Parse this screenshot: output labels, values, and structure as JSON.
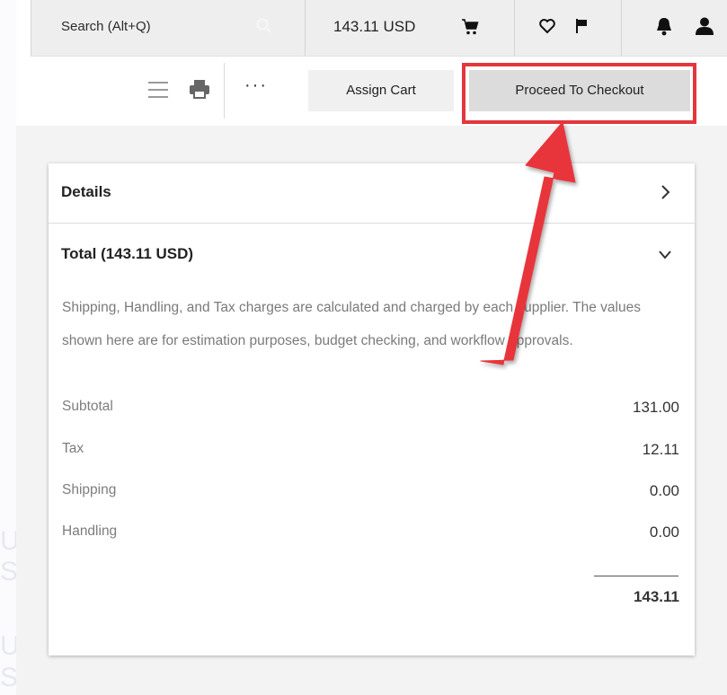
{
  "topbar": {
    "search_placeholder": "Search (Alt+Q)",
    "cart_total": "143.11 USD",
    "icons": [
      "search-icon",
      "cart-icon",
      "heart-icon",
      "flag-icon",
      "bell-icon",
      "user-icon"
    ]
  },
  "toolbar": {
    "more_label": "···",
    "assign_cart_label": "Assign Cart",
    "checkout_label": "Proceed To Checkout",
    "icons": [
      "menu-icon",
      "print-icon"
    ]
  },
  "summary": {
    "details_label": "Details",
    "total_label": "Total (143.11 USD)",
    "note": "Shipping, Handling, and Tax charges are calculated and charged by each supplier. The values shown here are for estimation purposes, budget checking, and workflow approvals.",
    "rows": [
      {
        "label": "Subtotal",
        "value": "131.00"
      },
      {
        "label": "Tax",
        "value": "12.11"
      },
      {
        "label": "Shipping",
        "value": "0.00"
      },
      {
        "label": "Handling",
        "value": "0.00"
      }
    ],
    "grand_total": "143.11"
  },
  "colors": {
    "annotation": "#e4363d",
    "checkout_button": "#dcdcdc",
    "page_background": "#f3f3f3"
  }
}
